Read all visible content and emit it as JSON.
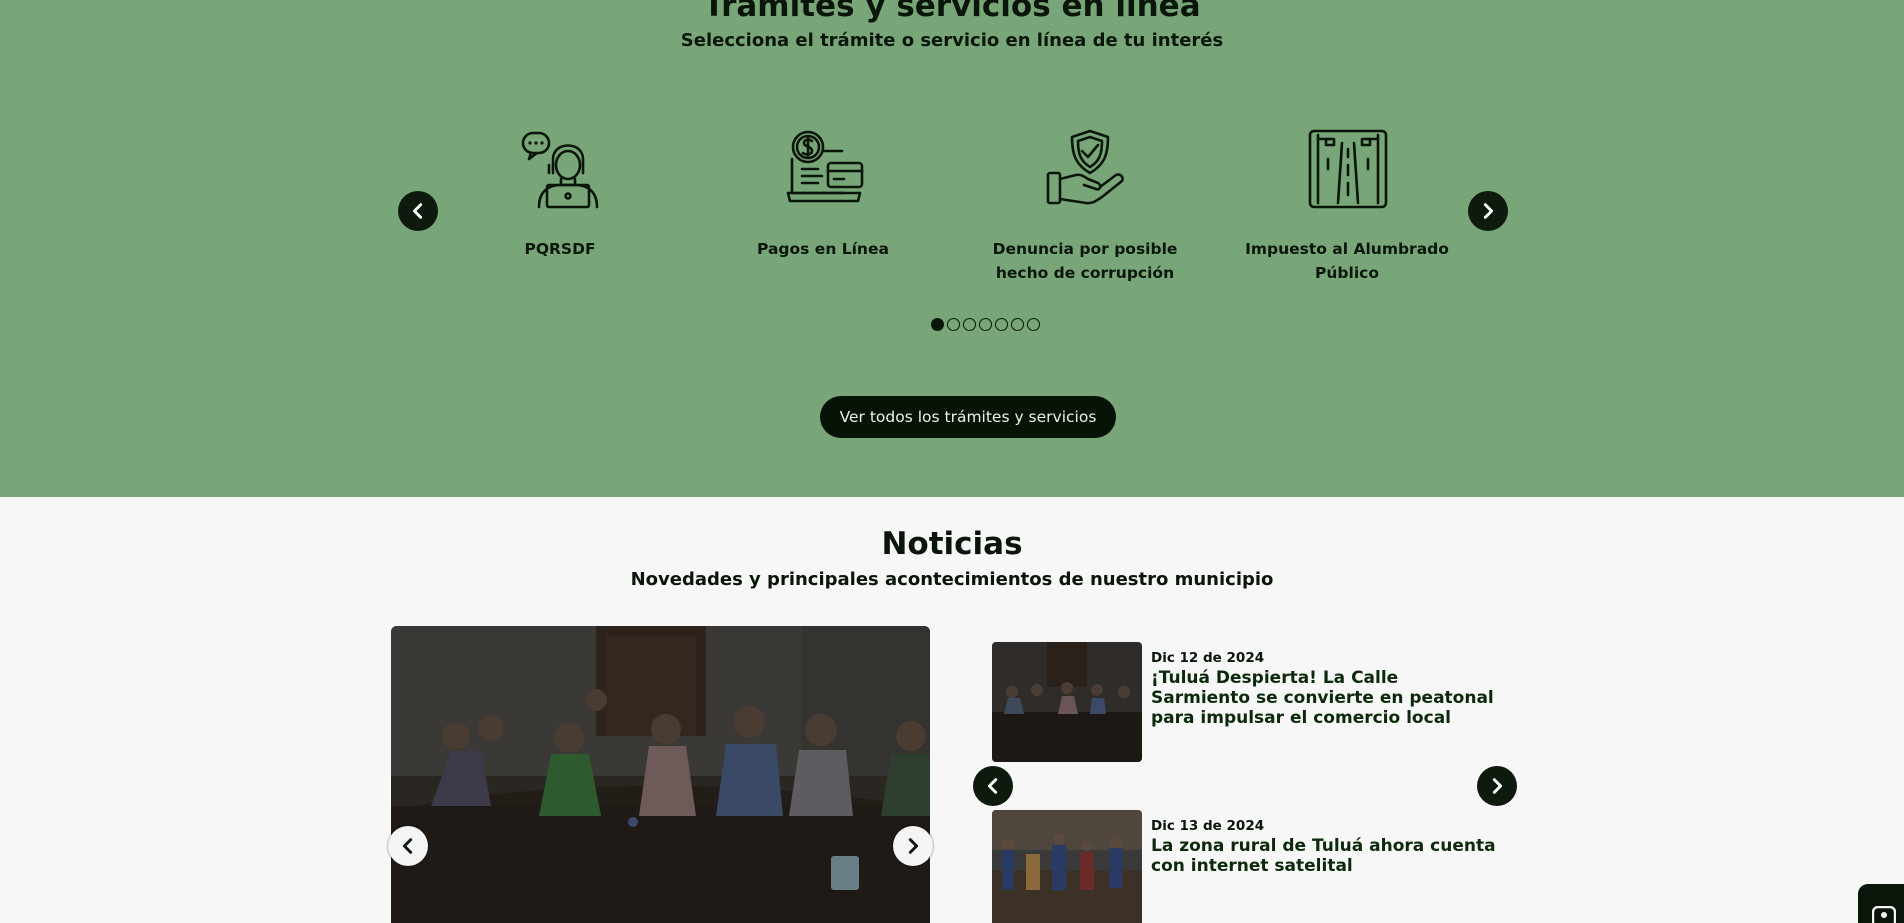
{
  "tramites": {
    "title": "Trámites y servicios en línea",
    "subtitle": "Selecciona el trámite o servicio en línea de tu interés",
    "services": [
      {
        "label": "PQRSDF",
        "icon": "customer-service-icon"
      },
      {
        "label": "Pagos en Línea",
        "icon": "online-payment-icon"
      },
      {
        "label": "Denuncia por posible hecho de corrupción",
        "icon": "shield-hand-icon"
      },
      {
        "label": "Impuesto al Alumbrado Público",
        "icon": "street-lights-icon"
      }
    ],
    "dots_total": 7,
    "dots_active": 1,
    "button_label": "Ver todos los trámites y servicios"
  },
  "noticias": {
    "title": "Noticias",
    "subtitle": "Novedades y principales acontecimientos de nuestro municipio",
    "items": [
      {
        "date": "Dic 12 de 2024",
        "title": "¡Tuluá Despierta! La Calle Sarmiento se convierte en peatonal para impulsar el comercio local"
      },
      {
        "date": "Dic 13 de 2024",
        "title": "La zona rural de Tuluá ahora cuenta con internet satelital"
      }
    ]
  },
  "colors": {
    "section_green": "#78a678",
    "dark": "#0b160b",
    "page_bg": "#f7f7f7"
  }
}
